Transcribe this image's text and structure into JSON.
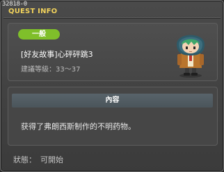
{
  "window": {
    "id_label": "32818-0",
    "title": "QUEST INFO"
  },
  "quest": {
    "category": "一般",
    "name": "[好友故事]心砰砰跳3",
    "level_label": "建議等級",
    "level_range": "33～37"
  },
  "content": {
    "header": "內容",
    "text": "获得了弗朗西斯制作的不明药物。"
  },
  "status": {
    "label": "狀態：",
    "value": "可開始"
  },
  "icons": [
    "npc-portrait"
  ],
  "colors": {
    "title": "#f2d35c",
    "category_badge": "#7fbf2a",
    "content_header": "#58636a"
  }
}
